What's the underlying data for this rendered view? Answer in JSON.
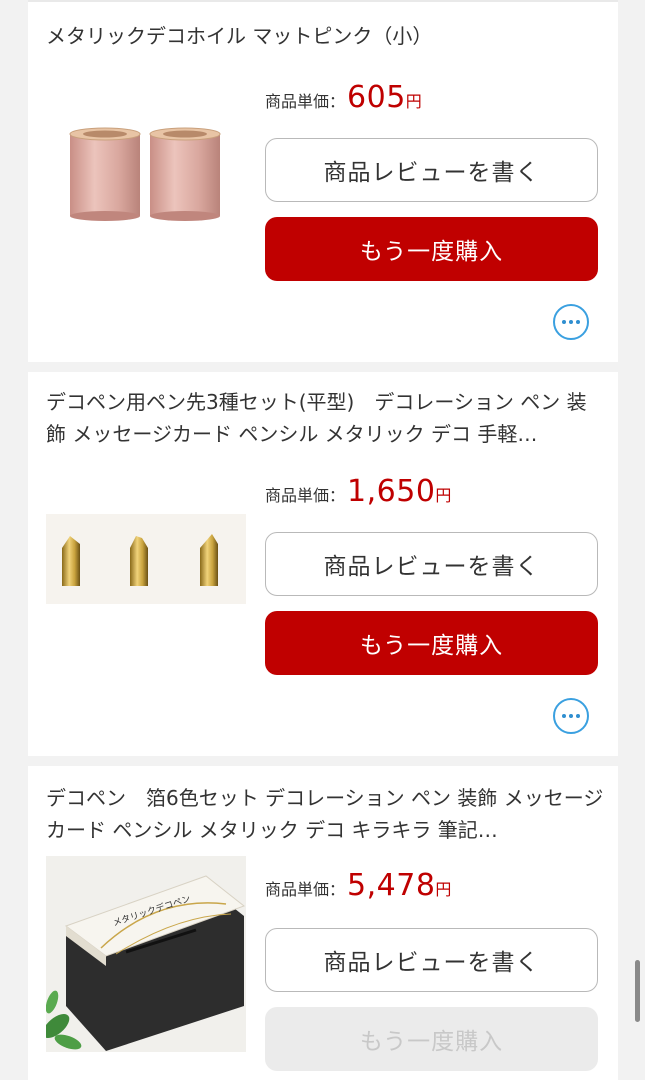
{
  "items": [
    {
      "title": "メタリックデコホイル マットピンク（小）",
      "price_label": "商品単価：",
      "price_value": "605",
      "price_unit": "円",
      "review_label": "商品レビューを書く",
      "buy_label": "もう一度購入",
      "buy_enabled": true
    },
    {
      "title": "デコペン用ペン先3種セット(平型)　デコレーション ペン 装飾 メッセージカード ペンシル メタリック デコ 手軽…",
      "price_label": "商品単価：",
      "price_value": "1,650",
      "price_unit": "円",
      "review_label": "商品レビューを書く",
      "buy_label": "もう一度購入",
      "buy_enabled": true
    },
    {
      "title": "デコペン　箔6色セット デコレーション ペン 装飾 メッセージカード ペンシル メタリック デコ キラキラ 筆記…",
      "price_label": "商品単価：",
      "price_value": "5,478",
      "price_unit": "円",
      "review_label": "商品レビューを書く",
      "buy_label": "もう一度購入",
      "buy_enabled": false,
      "image_text": "メタリックデコペン"
    }
  ],
  "colors": {
    "price": "#bf0000",
    "buy_button": "#c00000",
    "more_icon": "#3aa0e0"
  },
  "icons": {
    "more": "ellipsis-circle-icon"
  }
}
